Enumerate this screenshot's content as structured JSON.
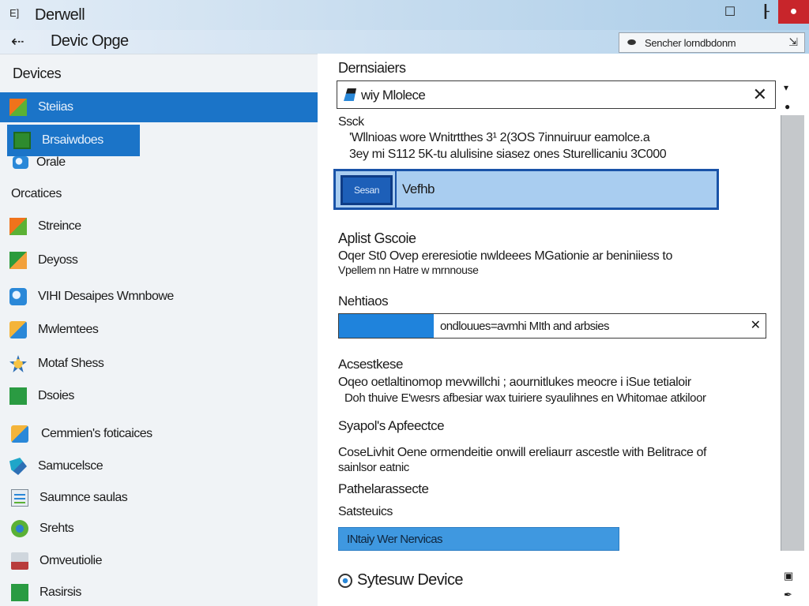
{
  "window": {
    "app_icon": "E]",
    "app_title": "Derwell",
    "min_glyph": "☐",
    "max_glyph": "┠",
    "close_glyph": "●"
  },
  "nav": {
    "back_glyph": "⇠",
    "page_title": "Devic Opge",
    "search_icon": "⬬",
    "search_value": "Sencher lorndbdonm",
    "search_edit_glyph": "⇲"
  },
  "sidebar": {
    "heading_1": "Devices",
    "heading_2": "Orcatices",
    "items": [
      {
        "label": "Steiias",
        "icon": "windows-icon"
      },
      {
        "label": "Brsaiwdoes",
        "icon": "green-square-icon"
      },
      {
        "label": "Orale",
        "icon": "window-icon"
      },
      {
        "label": "Streince",
        "icon": "windows-icon"
      },
      {
        "label": "Deyoss",
        "icon": "windows-icon"
      },
      {
        "label": "VIHI Desaipes Wmnbowe",
        "icon": "device-icon"
      },
      {
        "label": "Mwlemtees",
        "icon": "orange-windows-icon"
      },
      {
        "label": "Motaf Shess",
        "icon": "star-icon"
      },
      {
        "label": "Dsoies",
        "icon": "green-square-icon"
      },
      {
        "label": "Cemmien's foticaices",
        "icon": "blue-windows-icon"
      },
      {
        "label": "Samucelsce",
        "icon": "teal-icon"
      },
      {
        "label": "Saumnce saulas",
        "icon": "document-icon"
      },
      {
        "label": "Srehts",
        "icon": "gear-icon"
      },
      {
        "label": "Omveutiolie",
        "icon": "tray-icon"
      },
      {
        "label": "Rasirsis",
        "icon": "green-square-icon"
      }
    ]
  },
  "main": {
    "section_title": "Dernsiaiers",
    "device_input": {
      "value": "wiy Mlolece",
      "clear_glyph": "✕"
    },
    "seek_heading": "Ssck",
    "desc_line_1": "'Wllnioas wore Wnitrtthes 3¹ 2(3OS 7innuiruur eamolce.a",
    "desc_line_2": "3ey mi S112 5K-tu alulisine siasez ones Sturellicaniu 3C000",
    "verify": {
      "button_label": "Sesan",
      "label": "Vefhb"
    },
    "apist_heading": "Aplist Gscoie",
    "apist_line_1": "Oqer St0 Ovep ereresiotie nwldeees MGationie ar beniniiess to",
    "apist_line_2": "Vpellem nn Hatre w mrnnouse",
    "network_heading": "Nehtiaos",
    "network_select": {
      "value": "ondlouues=avmhi MIth and arbsies",
      "chevron": "✕"
    },
    "assist_heading": "Acsestkese",
    "assist_line_1": "Oqeo oetlaltinomop mevwillchi ; aournitlukes meocre i iSue tetialoir",
    "assist_line_2": "Doh thuive E'wesrs afbesiar wax tuiriere syaulihnes en Whitomae atkiloor",
    "sysport_heading": "Syapol's Apfeectce",
    "sysport_line_1": "CoseLivhit Oene ormendeitie onwill ereliaurr ascestle with Belitrace of",
    "sysport_line_2": "sainlsor eatnic",
    "pathe_heading": "Pathelarassecte",
    "status_heading": "Satsteuics",
    "wide_button": "INtaiy Wer Nervicas",
    "footer_label": "Sytesuw Device"
  },
  "scrollbar": {
    "up_glyph": "▾",
    "dot_glyph": "●",
    "b1_glyph": "▣",
    "b2_glyph": "✒"
  },
  "colors": {
    "accent": "#1b74c8",
    "close": "#c8252b",
    "select_fill": "#1f83dc"
  }
}
